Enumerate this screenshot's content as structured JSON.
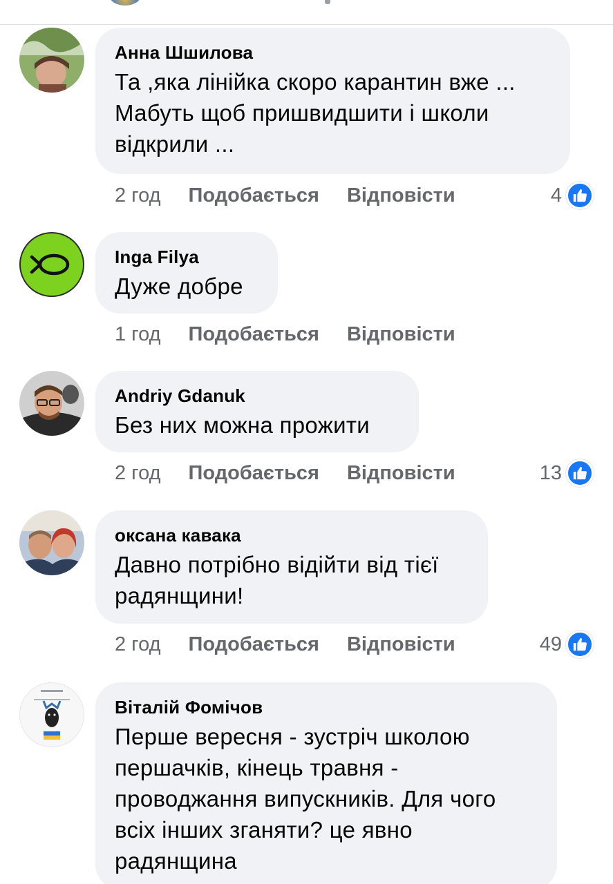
{
  "colors": {
    "bubble_bg": "#f0f2f5",
    "meta_text": "#65676b",
    "like_blue": "#1877f2"
  },
  "comments": [
    {
      "author": "Анна Шшилова",
      "lines": [
        "Та ,яка лінійка скоро карантин вже ...",
        "Мабуть щоб пришвидшити і школи",
        "відкрили ..."
      ],
      "time": "2 год",
      "like_label": "Подобається",
      "reply_label": "Відповісти",
      "reactions": "4",
      "reaction_icon": "thumbs-up-icon"
    },
    {
      "author": "Inga Filya",
      "lines": [
        "Дуже добре"
      ],
      "time": "1 год",
      "like_label": "Подобається",
      "reply_label": "Відповісти"
    },
    {
      "author": "Andriy Gdanuk",
      "lines": [
        "Без них можна прожити"
      ],
      "time": "2 год",
      "like_label": "Подобається",
      "reply_label": "Відповісти",
      "reactions": "13",
      "reaction_icon": "thumbs-up-icon"
    },
    {
      "author": "оксана кавака",
      "lines": [
        "Давно потрібно відійти від тієї",
        "радянщини!"
      ],
      "time": "2 год",
      "like_label": "Подобається",
      "reply_label": "Відповісти",
      "reactions": "49",
      "reaction_icon": "thumbs-up-icon"
    },
    {
      "author": "Віталій Фомічов",
      "lines": [
        "Перше вересня - зустріч школою",
        "першачків, кінець травня -",
        "проводжання випускників. Для чого",
        "всіх інших зганяти? це явно",
        "радянщина"
      ]
    }
  ]
}
